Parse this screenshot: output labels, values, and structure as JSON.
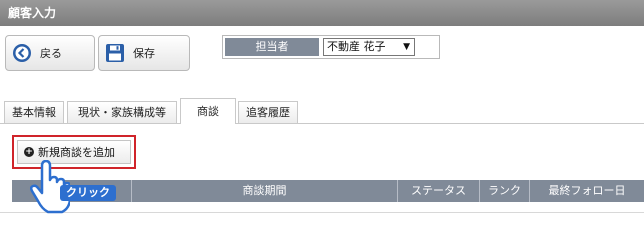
{
  "window": {
    "title": "顧客入力"
  },
  "toolbar": {
    "back_label": "戻る",
    "save_label": "保存",
    "back_icon": "left-arrow-circle-icon",
    "save_icon": "floppy-disk-icon"
  },
  "assignee": {
    "label": "担当者",
    "value": "不動産 花子"
  },
  "tabs": [
    {
      "label": "基本情報"
    },
    {
      "label": "現状・家族構成等"
    },
    {
      "label": "商談"
    },
    {
      "label": "追客履歴"
    }
  ],
  "add_deal": {
    "label": "新規商談を追加"
  },
  "table": {
    "columns": [
      {
        "label": ""
      },
      {
        "label": "商談期間"
      },
      {
        "label": "ステータス"
      },
      {
        "label": "ランク"
      },
      {
        "label": "最終フォロー日"
      }
    ]
  },
  "callout": {
    "label": "クリック"
  },
  "colors": {
    "highlight": "#d0242a",
    "header": "#808a98",
    "callout": "#2d6fcf"
  }
}
